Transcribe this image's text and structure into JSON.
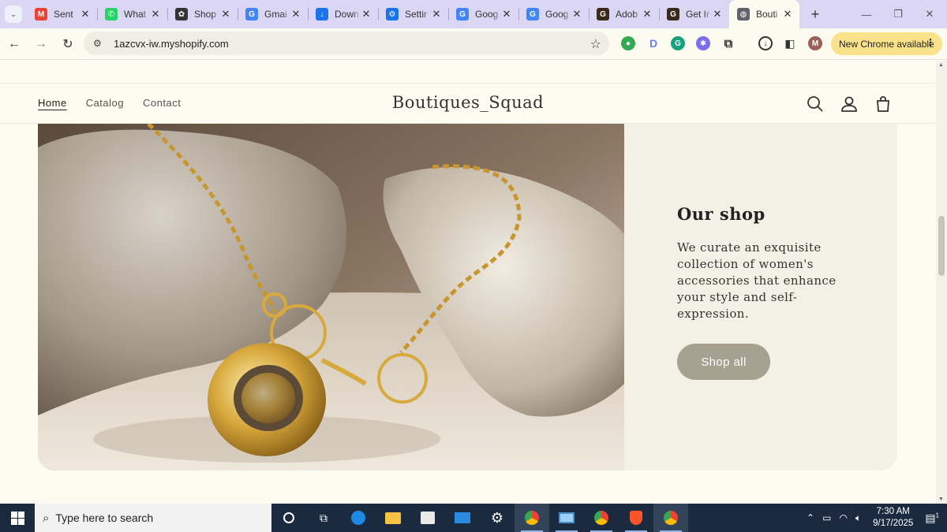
{
  "browser": {
    "tab_search_icon": "chevron-down-icon",
    "tabs": [
      {
        "title": "Sent",
        "favicon": "gmail-icon",
        "color": "#ea4335"
      },
      {
        "title": "What",
        "favicon": "whatsapp-icon",
        "color": "#25d366"
      },
      {
        "title": "Shop",
        "favicon": "openai-icon",
        "color": "#333333"
      },
      {
        "title": "Gmai",
        "favicon": "google-icon",
        "color": "#4285f4"
      },
      {
        "title": "Down",
        "favicon": "download-icon",
        "color": "#1a73e8"
      },
      {
        "title": "Settir",
        "favicon": "settings-icon",
        "color": "#1a73e8"
      },
      {
        "title": "Goog",
        "favicon": "google-icon",
        "color": "#4285f4"
      },
      {
        "title": "Goog",
        "favicon": "google-icon",
        "color": "#4285f4"
      },
      {
        "title": "Adob",
        "favicon": "g-icon",
        "color": "#3a2a1a"
      },
      {
        "title": "Get Ir",
        "favicon": "g-icon",
        "color": "#3a2a1a"
      },
      {
        "title": "Bouti",
        "favicon": "globe-icon",
        "color": "#5f6368",
        "active": true
      }
    ],
    "new_tab": "+",
    "url": "1azcvx-iw.myshopify.com",
    "profile_initial": "M",
    "update_label": "New Chrome available"
  },
  "site": {
    "nav": [
      {
        "label": "Home",
        "current": true
      },
      {
        "label": "Catalog"
      },
      {
        "label": "Contact"
      }
    ],
    "brand": "Boutiques_Squad",
    "header_icons": [
      "search-icon",
      "account-icon",
      "cart-icon"
    ]
  },
  "hero": {
    "title": "Our shop",
    "body": "We curate an exquisite collection of women's accessories that enhance your style and self-expression.",
    "button": "Shop all",
    "image": "gold-necklace-on-stones-image",
    "button_color": "#a7a191"
  },
  "taskbar": {
    "search_placeholder": "Type here to search",
    "time": "7:30 AM",
    "date": "9/17/2025",
    "notification_count": "1"
  }
}
